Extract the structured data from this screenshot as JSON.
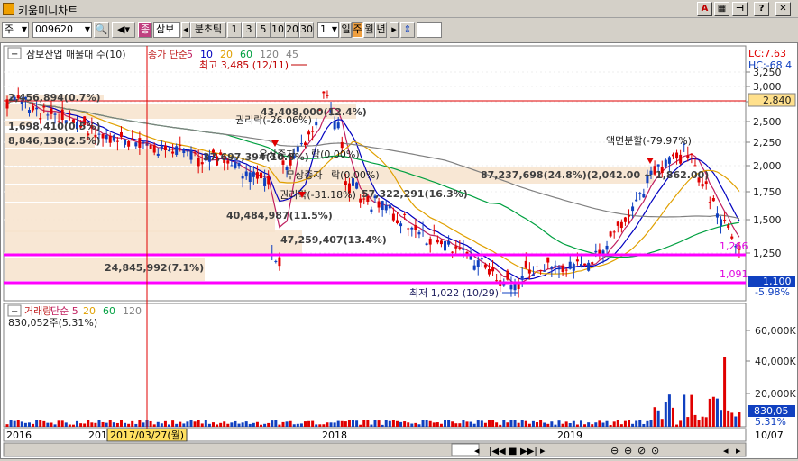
{
  "window": {
    "title": "키움미니차트"
  },
  "toolbar": {
    "market": "주",
    "code": "009620",
    "name": "삼보",
    "name_prefix": "종",
    "menu_left": "◂",
    "interval_label": "분초틱",
    "intervals": [
      "1",
      "3",
      "5",
      "10",
      "20",
      "30"
    ],
    "n_value": "1",
    "periods": [
      "일",
      "주",
      "월",
      "년"
    ],
    "active_period": "주"
  },
  "price_panel": {
    "header": "삼보산업 매물대 수(10)",
    "ma_label": "종가 단순 5 10 20 60 120 45",
    "ma_names": [
      "종가 단순",
      "5",
      "10",
      "20",
      "60",
      "120",
      "45"
    ],
    "lc": "LC:7.63",
    "hc": "HC:-68.4",
    "high_note": "최고 3,485 (12/11)",
    "low_note": "최저 1,022 (10/29)",
    "volume_profile": [
      "2,456,894(0.7%)",
      "43,408,000(12.4%)",
      "1,698,410(0.5%)",
      "8,846,138(2.5%)",
      "37,697,394(10.8%)",
      "87,237,698(24.8%)",
      "57,322,291(16.3%)",
      "40,484,987(11.5%)",
      "47,259,407(13.4%)",
      "24,845,992(7.1%)"
    ],
    "events": [
      "권리락(-26.06%)",
      "유상증자",
      "락(0.00%)",
      "무상증자",
      "락(0.00%)",
      "권리락(-31.18%)",
      "액면분할(-79.97%)"
    ],
    "split_note": "87,237,698(24.8%)(2,042.00 ~ 1,862.00)",
    "y_ticks": [
      "3,250",
      "3,000",
      "2,750",
      "2,500",
      "2,250",
      "2,000",
      "1,750",
      "1,500",
      "1,250"
    ],
    "current_price": "2,840",
    "line_price_1": "1,266",
    "line_price_2": "1,091",
    "last_price": "1,100",
    "last_change": "-5.98%"
  },
  "volume_panel": {
    "label": "거래량 단순 5 20 60 120",
    "label_names": [
      "거래량",
      "단순 5",
      "20",
      "60",
      "120"
    ],
    "value": "830,052주(5.31%)",
    "y_ticks": [
      "60,000K",
      "40,000K",
      "20,000K"
    ],
    "last_value": "830,05",
    "last_pct": "5.31%"
  },
  "x_axis": {
    "labels": [
      "2016",
      "2017",
      "2018",
      "2019",
      "10/07"
    ],
    "cursor_date": "2017/03/27(월)"
  },
  "colors": {
    "up": "#e00000",
    "down": "#1040c0",
    "ma5": "#c02060",
    "ma10": "#0000c0",
    "ma20": "#e0a000",
    "ma60": "#00a040",
    "ma120": "#808080",
    "magenta": "#ff00ff"
  }
}
